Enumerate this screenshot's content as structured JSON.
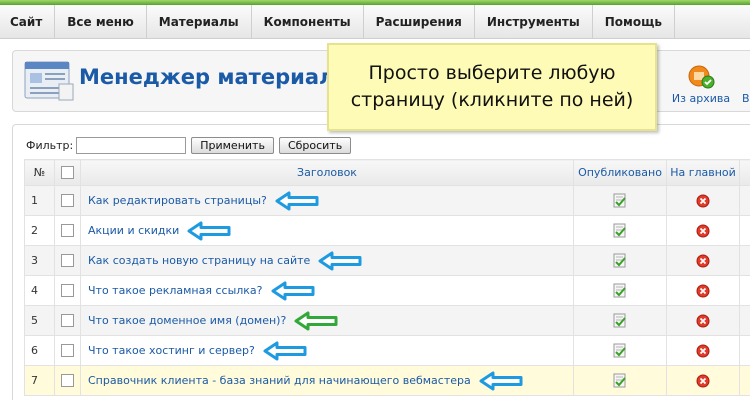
{
  "menu": {
    "items": [
      "Сайт",
      "Все меню",
      "Материалы",
      "Компоненты",
      "Расширения",
      "Инструменты",
      "Помощь"
    ]
  },
  "header": {
    "title": "Менеджер материалов",
    "icon": "articles-manager-icon"
  },
  "callout": {
    "text": "Просто выберите любую страницу (кликните по ней)",
    "background": "#fdfbb5"
  },
  "toolbar": {
    "archive_label": "Из архива",
    "archive_icon": "unarchive-icon",
    "cut_label": "В"
  },
  "filter": {
    "label": "Фильтр:",
    "value": "",
    "apply_label": "Применить",
    "reset_label": "Сбросить"
  },
  "table": {
    "headers": {
      "num": "№",
      "title": "Заголовок",
      "published": "Опубликовано",
      "frontpage": "На главной"
    },
    "rows": [
      {
        "num": "1",
        "title": "Как редактировать страницы?",
        "published_icon": "checkmark-icon",
        "frontpage_icon": "red-x-icon",
        "arrow_color": "#1e9be0"
      },
      {
        "num": "2",
        "title": "Акции и скидки",
        "published_icon": "checkmark-icon",
        "frontpage_icon": "red-x-icon",
        "arrow_color": "#1e9be0"
      },
      {
        "num": "3",
        "title": "Как создать новую страницу на сайте",
        "published_icon": "checkmark-icon",
        "frontpage_icon": "red-x-icon",
        "arrow_color": "#1e9be0"
      },
      {
        "num": "4",
        "title": "Что такое рекламная ссылка?",
        "published_icon": "checkmark-icon",
        "frontpage_icon": "red-x-icon",
        "arrow_color": "#1e9be0"
      },
      {
        "num": "5",
        "title": "Что такое доменное имя (домен)?",
        "published_icon": "checkmark-icon",
        "frontpage_icon": "red-x-icon",
        "arrow_color": "#33a83a"
      },
      {
        "num": "6",
        "title": "Что такое хостинг и сервер?",
        "published_icon": "checkmark-icon",
        "frontpage_icon": "red-x-icon",
        "arrow_color": "#1e9be0"
      },
      {
        "num": "7",
        "title": "Справочник клиента - база знаний для начинающего вебмастера",
        "published_icon": "checkmark-icon",
        "frontpage_icon": "red-x-icon",
        "arrow_color": "#1e9be0"
      }
    ]
  },
  "colors": {
    "link": "#1b5aa6",
    "accent_green": "#5aa02c",
    "row_highlight": "#fffbdb"
  }
}
